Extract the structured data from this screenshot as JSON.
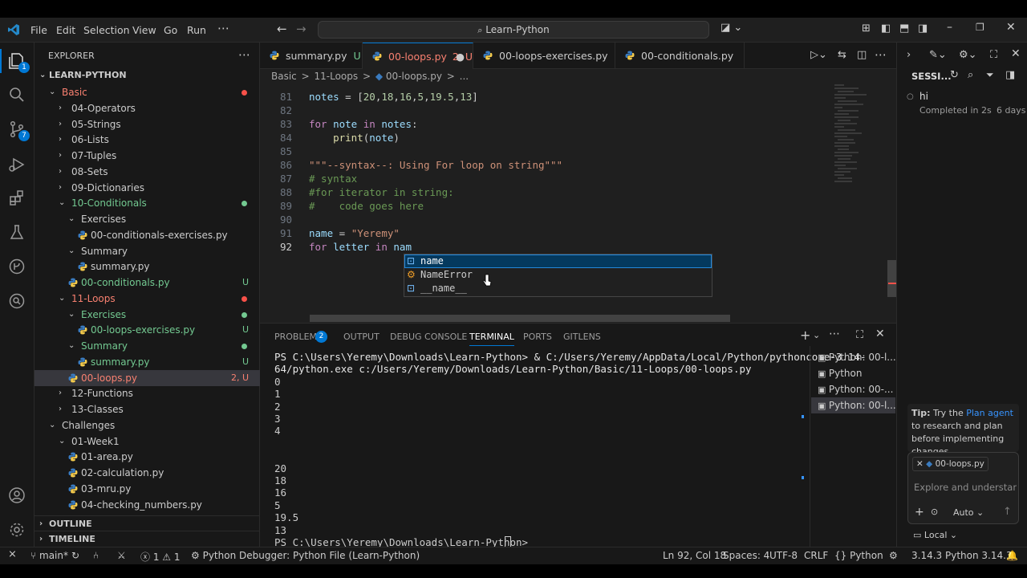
{
  "menu": [
    "File",
    "Edit",
    "Selection",
    "View",
    "Go",
    "Run"
  ],
  "command_center": "Learn-Python",
  "activity_badges": {
    "explorer": "1",
    "source_control": "7"
  },
  "sidebar": {
    "title": "EXPLORER",
    "root": "LEARN-PYTHON",
    "tree": [
      {
        "label": "Basic",
        "status": ""
      },
      {
        "label": "04-Operators",
        "status": ""
      },
      {
        "label": "05-Strings",
        "status": ""
      },
      {
        "label": "06-Lists",
        "status": ""
      },
      {
        "label": "07-Tuples",
        "status": ""
      },
      {
        "label": "08-Sets",
        "status": ""
      },
      {
        "label": "09-Dictionaries",
        "status": ""
      },
      {
        "label": "10-Conditionals",
        "status": ""
      },
      {
        "label": "Exercises",
        "status": ""
      },
      {
        "label": "00-conditionals-exercises.py",
        "status": ""
      },
      {
        "label": "Summary",
        "status": ""
      },
      {
        "label": "summary.py",
        "status": ""
      },
      {
        "label": "00-conditionals.py",
        "status": "U"
      },
      {
        "label": "11-Loops",
        "status": ""
      },
      {
        "label": "Exercises",
        "status": ""
      },
      {
        "label": "00-loops-exercises.py",
        "status": "U"
      },
      {
        "label": "Summary",
        "status": ""
      },
      {
        "label": "summary.py",
        "status": "U"
      },
      {
        "label": "00-loops.py",
        "status": "2, U"
      },
      {
        "label": "12-Functions",
        "status": ""
      },
      {
        "label": "13-Classes",
        "status": ""
      },
      {
        "label": "Challenges",
        "status": ""
      },
      {
        "label": "01-Week1",
        "status": ""
      },
      {
        "label": "01-area.py",
        "status": ""
      },
      {
        "label": "02-calculation.py",
        "status": ""
      },
      {
        "label": "03-mru.py",
        "status": ""
      },
      {
        "label": "04-checking_numbers.py",
        "status": ""
      }
    ],
    "outline": "OUTLINE",
    "timeline": "TIMELINE"
  },
  "tabs": [
    {
      "name": "summary.py",
      "status": "U"
    },
    {
      "name": "00-loops.py",
      "status": "2, U"
    },
    {
      "name": "00-loops-exercises.py",
      "status": "U"
    },
    {
      "name": "00-conditionals.py",
      "status": "U"
    }
  ],
  "breadcrumb": [
    "Basic",
    ">",
    "11-Loops",
    ">",
    "00-loops.py",
    ">",
    "..."
  ],
  "editor": {
    "line_numbers": [
      "81",
      "82",
      "83",
      "84",
      "85",
      "86",
      "87",
      "88",
      "89",
      "90",
      "91",
      "92"
    ],
    "lines": [
      "notes = [20,18,16,5,19.5,13]",
      "",
      "for note in notes:",
      "    print(note)",
      "",
      "\"\"\"--syntax--: Using For loop on string\"\"\"",
      "# syntax",
      "#for iterator in string:",
      "#    code goes here",
      "",
      "name = \"Yeremy\"",
      "for letter in nam"
    ],
    "suggestions": [
      "name",
      "NameError",
      "__name__"
    ]
  },
  "panel": {
    "tabs": [
      "PROBLEMS",
      "OUTPUT",
      "DEBUG CONSOLE",
      "TERMINAL",
      "PORTS",
      "GITLENS"
    ],
    "problems_count": "2",
    "terminal_lines": [
      "PS C:\\Users\\Yeremy\\Downloads\\Learn-Python> & C:/Users/Yeremy/AppData/Local/Python/pythoncore-3.14-",
      "64/python.exe c:/Users/Yeremy/Downloads/Learn-Python/Basic/11-Loops/00-loops.py",
      "0",
      "1",
      "2",
      "3",
      "4",
      "",
      "",
      "20",
      "18",
      "16",
      "5",
      "19.5",
      "13",
      "PS C:\\Users\\Yeremy\\Downloads\\Learn-Python> "
    ],
    "terminal_list": [
      "Python: 00-l...",
      "Python",
      "Python: 00-...",
      "Python: 00-l..."
    ]
  },
  "chat": {
    "header": "SESSI...",
    "session_title": "hi",
    "session_status": "Completed in 2s",
    "session_age": "6 days",
    "tip_prefix": "Tip:",
    "tip_mid": " Try the ",
    "tip_link": "Plan agent",
    "tip_rest": " to research and plan before implementing changes.",
    "attachment": "00-loops.py",
    "input_placeholder": "Explore and understand y",
    "mode": "Auto",
    "location": "Local"
  },
  "status": {
    "branch": "main*",
    "errors": "1",
    "warnings": "1",
    "debugger": "Python Debugger: Python File (Learn-Python)",
    "position": "Ln 92, Col 18",
    "spaces": "Spaces: 4",
    "encoding": "UTF-8",
    "eol": "CRLF",
    "language": "Python",
    "py_version": "3.14.3",
    "interpreter": "Python 3.14.3"
  },
  "colors": {
    "accent": "#0078d4",
    "modified": "#73c991",
    "warning": "#e2c08d",
    "error": "#f85149"
  }
}
